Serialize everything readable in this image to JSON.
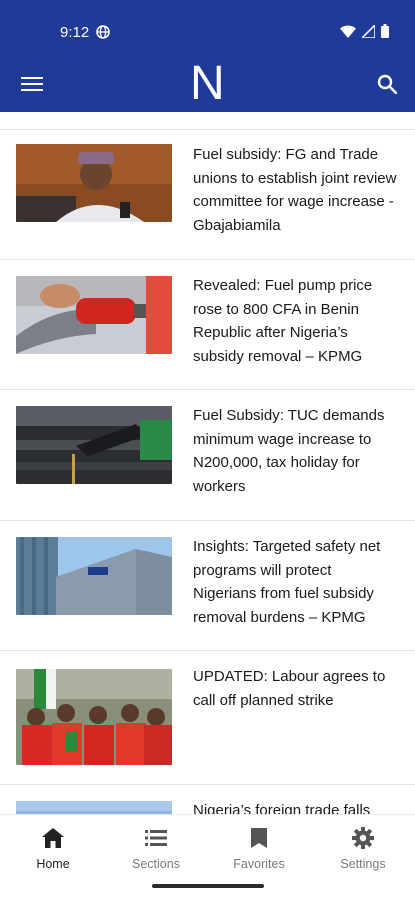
{
  "status_bar": {
    "time": "9:12"
  },
  "app_bar": {
    "logo_text": "N",
    "menu_icon": "hamburger-menu-icon",
    "search_icon": "search-icon",
    "color": "#1f3a97"
  },
  "articles": [
    {
      "headline": "Fuel subsidy: FG and Trade unions to establish joint review committee for wage increase - Gbajabiamila"
    },
    {
      "headline": "Revealed: Fuel pump price rose to 800 CFA in Benin Republic after Nigeria’s subsidy removal – KPMG"
    },
    {
      "headline": "Fuel Subsidy: TUC demands minimum wage increase to N200,000, tax holiday for workers"
    },
    {
      "headline": "Insights: Targeted safety net programs will protect Nigerians from fuel subsidy removal burdens – KPMG"
    },
    {
      "headline": "UPDATED: Labour agrees to call off planned strike"
    },
    {
      "headline": "Nigeria’s foreign trade falls"
    }
  ],
  "bottom_nav": {
    "items": [
      {
        "label": "Home",
        "icon": "home-icon",
        "active": true
      },
      {
        "label": "Sections",
        "icon": "sections-list-icon",
        "active": false
      },
      {
        "label": "Favorites",
        "icon": "bookmark-icon",
        "active": false
      },
      {
        "label": "Settings",
        "icon": "gear-icon",
        "active": false
      }
    ]
  }
}
